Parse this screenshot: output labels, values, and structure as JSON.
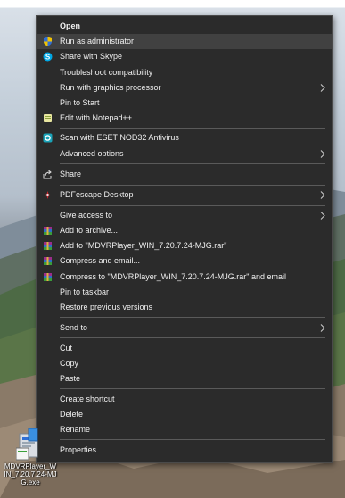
{
  "menu": {
    "items": [
      {
        "label": "Open",
        "icon": "none",
        "bold": true
      },
      {
        "label": "Run as administrator",
        "icon": "uac-shield-icon"
      },
      {
        "label": "Share with Skype",
        "icon": "skype-icon"
      },
      {
        "label": "Troubleshoot compatibility",
        "icon": "none"
      },
      {
        "label": "Run with graphics processor",
        "icon": "none",
        "submenu": true
      },
      {
        "label": "Pin to Start",
        "icon": "none"
      },
      {
        "label": "Edit with Notepad++",
        "icon": "notepad-plus-plus-icon"
      },
      {
        "label": "Scan with ESET NOD32 Antivirus",
        "icon": "eset-icon"
      },
      {
        "label": "Advanced options",
        "icon": "none",
        "submenu": true
      },
      {
        "label": "Share",
        "icon": "share-icon"
      },
      {
        "label": "PDFescape Desktop",
        "icon": "pdfescape-icon",
        "submenu": true
      },
      {
        "label": "Give access to",
        "icon": "none",
        "submenu": true
      },
      {
        "label": "Add to archive...",
        "icon": "winrar-icon"
      },
      {
        "label": "Add to \"MDVRPlayer_WIN_7.20.7.24-MJG.rar\"",
        "icon": "winrar-icon"
      },
      {
        "label": "Compress and email...",
        "icon": "winrar-icon"
      },
      {
        "label": "Compress to \"MDVRPlayer_WIN_7.20.7.24-MJG.rar\" and email",
        "icon": "winrar-icon"
      },
      {
        "label": "Pin to taskbar",
        "icon": "none"
      },
      {
        "label": "Restore previous versions",
        "icon": "none"
      },
      {
        "label": "Send to",
        "icon": "none",
        "submenu": true
      },
      {
        "label": "Cut",
        "icon": "none"
      },
      {
        "label": "Copy",
        "icon": "none"
      },
      {
        "label": "Paste",
        "icon": "none"
      },
      {
        "label": "Create shortcut",
        "icon": "none"
      },
      {
        "label": "Delete",
        "icon": "none"
      },
      {
        "label": "Rename",
        "icon": "none"
      },
      {
        "label": "Properties",
        "icon": "none"
      }
    ]
  },
  "desktop_icon": {
    "label": "MDVRPlayer_WIN_7.20.7.24-MJG.exe",
    "icon": "setup-installer-icon"
  },
  "colors": {
    "menu_bg": "#2b2b2b",
    "menu_hover": "#414141",
    "menu_text": "#f0f0f0",
    "separator": "#5a5a5a"
  }
}
